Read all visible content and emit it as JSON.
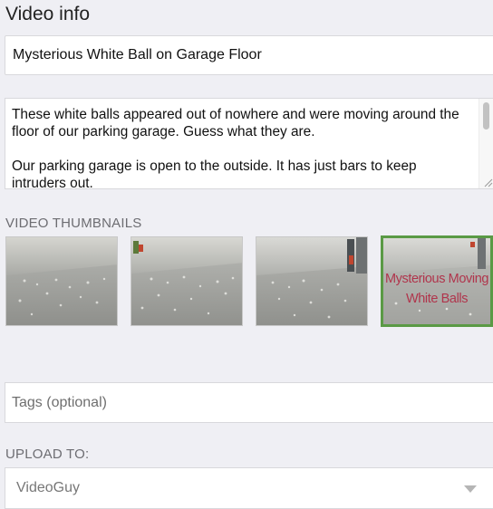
{
  "section": {
    "title": "Video info"
  },
  "title_field": {
    "value": "Mysterious White Ball on Garage Floor"
  },
  "description": {
    "value": "These white balls appeared out of nowhere and were moving around the floor of our parking garage. Guess what they are.\n\nOur parking garage is open to the outside. It has just bars to keep intruders out."
  },
  "thumbnails": {
    "label": "VIDEO THUMBNAILS",
    "selected_index": 3,
    "custom_overlay": "Mysterious Moving White Balls"
  },
  "tags": {
    "placeholder": "Tags (optional)",
    "value": ""
  },
  "upload": {
    "label": "UPLOAD TO:",
    "selected": "VideoGuy"
  },
  "colors": {
    "background": "#efeff4",
    "selected_border": "#5a9a45",
    "overlay_text": "#b0354c"
  }
}
